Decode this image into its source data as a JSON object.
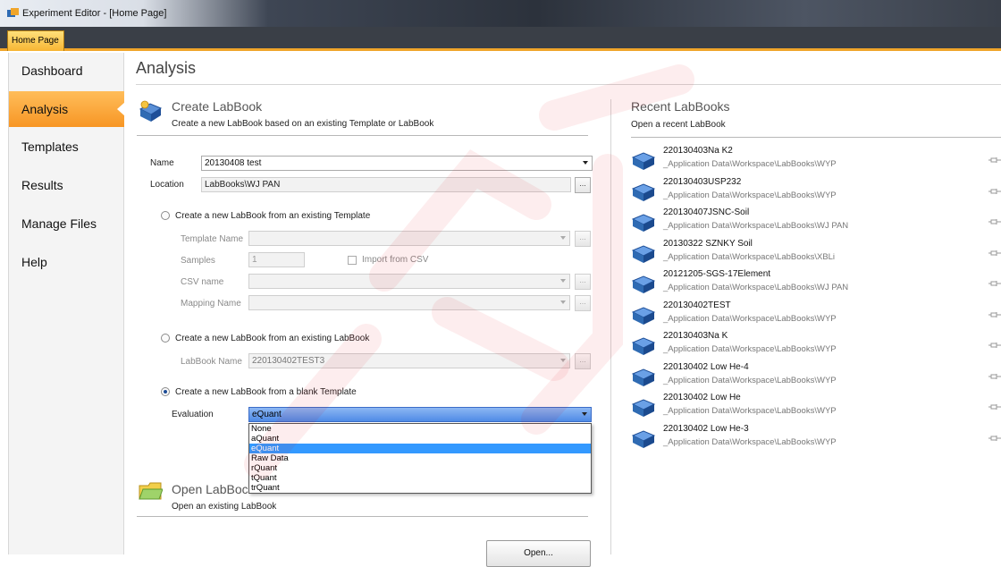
{
  "window": {
    "title": "Experiment Editor - [Home Page]"
  },
  "tabs": [
    {
      "label": "Home Page"
    }
  ],
  "sidebar": {
    "items": [
      {
        "label": "Dashboard"
      },
      {
        "label": "Analysis"
      },
      {
        "label": "Templates"
      },
      {
        "label": "Results"
      },
      {
        "label": "Manage Files"
      },
      {
        "label": "Help"
      }
    ],
    "active": "Analysis"
  },
  "page": {
    "title": "Analysis"
  },
  "create": {
    "title": "Create LabBook",
    "subtitle": "Create a new LabBook based on an existing Template or LabBook",
    "name_label": "Name",
    "name_value": "20130408 test",
    "location_label": "Location",
    "location_value": "LabBooks\\WJ PAN",
    "browse": "...",
    "option_template": {
      "label": "Create a new LabBook from an existing Template",
      "template_name_label": "Template Name",
      "samples_label": "Samples",
      "samples_value": "1",
      "import_csv_label": "Import from CSV",
      "csv_name_label": "CSV name",
      "mapping_name_label": "Mapping Name"
    },
    "option_labbook": {
      "label": "Create a new LabBook from an existing LabBook",
      "labbook_name_label": "LabBook Name",
      "labbook_name_value": "220130402TEST3"
    },
    "option_blank": {
      "label": "Create a new LabBook from a blank Template",
      "evaluation_label": "Evaluation",
      "evaluation_value": "eQuant",
      "evaluation_options": [
        "None",
        "aQuant",
        "eQuant",
        "Raw Data",
        "rQuant",
        "tQuant",
        "trQuant"
      ]
    },
    "selected_option": "blank"
  },
  "open": {
    "title": "Open LabBoc",
    "subtitle": "Open an existing LabBook",
    "button_label": "Open..."
  },
  "recent": {
    "title": "Recent LabBooks",
    "subtitle": "Open a recent LabBook",
    "items": [
      {
        "name": "220130403Na K2",
        "path": "_Application Data\\Workspace\\LabBooks\\WYP"
      },
      {
        "name": "220130403USP232",
        "path": "_Application Data\\Workspace\\LabBooks\\WYP"
      },
      {
        "name": "220130407JSNC-Soil",
        "path": "_Application Data\\Workspace\\LabBooks\\WJ PAN"
      },
      {
        "name": "20130322 SZNKY Soil",
        "path": "_Application Data\\Workspace\\LabBooks\\XBLi"
      },
      {
        "name": "20121205-SGS-17Element",
        "path": "_Application Data\\Workspace\\LabBooks\\WJ PAN"
      },
      {
        "name": "220130402TEST",
        "path": "_Application Data\\Workspace\\LabBooks\\WYP"
      },
      {
        "name": "220130403Na K",
        "path": "_Application Data\\Workspace\\LabBooks\\WYP"
      },
      {
        "name": "220130402 Low He-4",
        "path": "_Application Data\\Workspace\\LabBooks\\WYP"
      },
      {
        "name": "220130402 Low He",
        "path": "_Application Data\\Workspace\\LabBooks\\WYP"
      },
      {
        "name": "220130402 Low He-3",
        "path": "_Application Data\\Workspace\\LabBooks\\WYP"
      }
    ]
  },
  "colors": {
    "accent": "#f79624",
    "selection": "#3399ff",
    "watermark": "#e60012"
  }
}
